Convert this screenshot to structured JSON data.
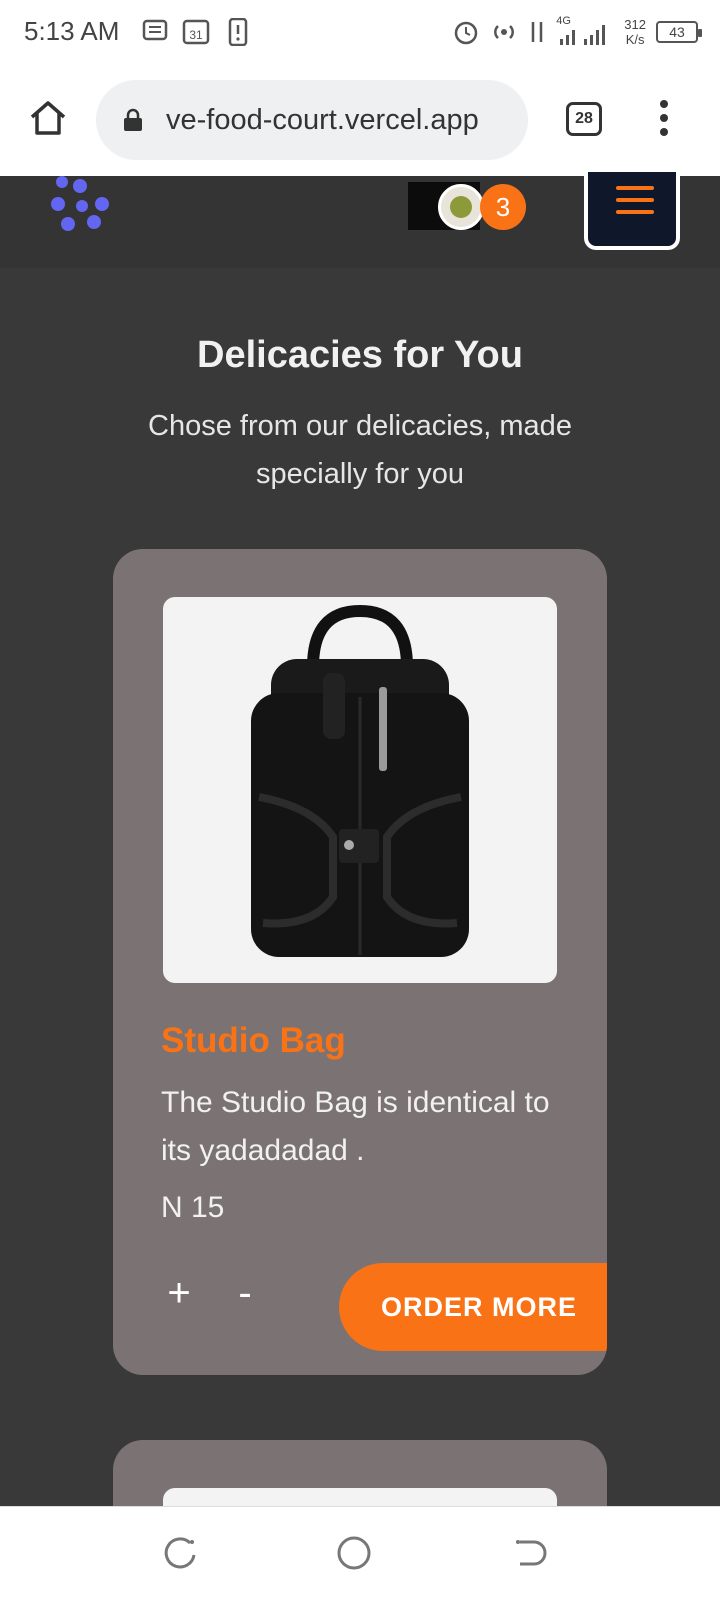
{
  "status_bar": {
    "time": "5:13 AM",
    "net_speed_value": "312",
    "net_speed_unit": "K/s",
    "battery": "43",
    "network_label": "4G"
  },
  "browser": {
    "url": "ve-food-court.vercel.app",
    "tab_count": "28"
  },
  "header": {
    "cart_count": "3"
  },
  "section": {
    "title": "Delicacies for You",
    "subtitle": "Chose from our delicacies, made specially for you"
  },
  "products": [
    {
      "name": "Studio Bag",
      "description": "The Studio Bag is identical to its yadadadad .",
      "price": "N 15",
      "plus_label": "+",
      "minus_label": "-",
      "order_label": "ORDER MORE"
    }
  ],
  "colors": {
    "accent": "#f97316",
    "page_bg": "#3a3939",
    "card_bg": "#7b7373",
    "header_bg": "#353434",
    "logo": "#6366f1"
  }
}
